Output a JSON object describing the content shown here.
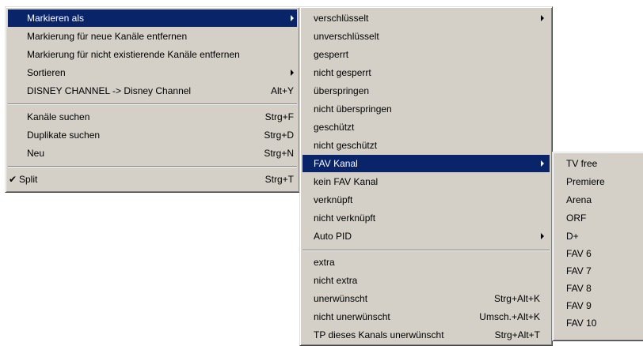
{
  "main_menu": {
    "items": [
      {
        "label": "Markieren als"
      },
      {
        "label": "Markierung für neue Kanäle entfernen"
      },
      {
        "label": "Markierung für nicht existierende Kanäle entfernen"
      },
      {
        "label": "Sortieren"
      },
      {
        "label": "DISNEY CHANNEL -> Disney Channel",
        "shortcut": "Alt+Y"
      },
      {
        "label": "Kanäle suchen",
        "shortcut": "Strg+F"
      },
      {
        "label": "Duplikate suchen",
        "shortcut": "Strg+D"
      },
      {
        "label": "Neu",
        "shortcut": "Strg+N"
      },
      {
        "label": "Split",
        "shortcut": "Strg+T"
      }
    ]
  },
  "mark_submenu": {
    "items": [
      {
        "label": "verschlüsselt"
      },
      {
        "label": "unverschlüsselt"
      },
      {
        "label": "gesperrt"
      },
      {
        "label": "nicht gesperrt"
      },
      {
        "label": "überspringen"
      },
      {
        "label": "nicht überspringen"
      },
      {
        "label": "geschützt"
      },
      {
        "label": "nicht geschützt"
      },
      {
        "label": "FAV Kanal"
      },
      {
        "label": "kein FAV Kanal"
      },
      {
        "label": "verknüpft"
      },
      {
        "label": "nicht verknüpft"
      },
      {
        "label": "Auto PID"
      },
      {
        "label": "extra"
      },
      {
        "label": "nicht extra"
      },
      {
        "label": "unerwünscht",
        "shortcut": "Strg+Alt+K"
      },
      {
        "label": "nicht unerwünscht",
        "shortcut": "Umsch.+Alt+K"
      },
      {
        "label": "TP dieses Kanals unerwünscht",
        "shortcut": "Strg+Alt+T"
      }
    ]
  },
  "fav_submenu": {
    "items": [
      {
        "label": "TV free"
      },
      {
        "label": "Premiere"
      },
      {
        "label": "Arena"
      },
      {
        "label": "ORF"
      },
      {
        "label": "D+"
      },
      {
        "label": "FAV 6"
      },
      {
        "label": "FAV 7"
      },
      {
        "label": "FAV 8"
      },
      {
        "label": "FAV 9"
      },
      {
        "label": "FAV 10"
      }
    ]
  },
  "colors": {
    "menu_bg": "#d4d0c8",
    "highlight": "#0a246a",
    "highlight_text": "#ffffff"
  },
  "icons": {
    "submenu_arrow": "triangle-right",
    "checkmark": "check"
  }
}
